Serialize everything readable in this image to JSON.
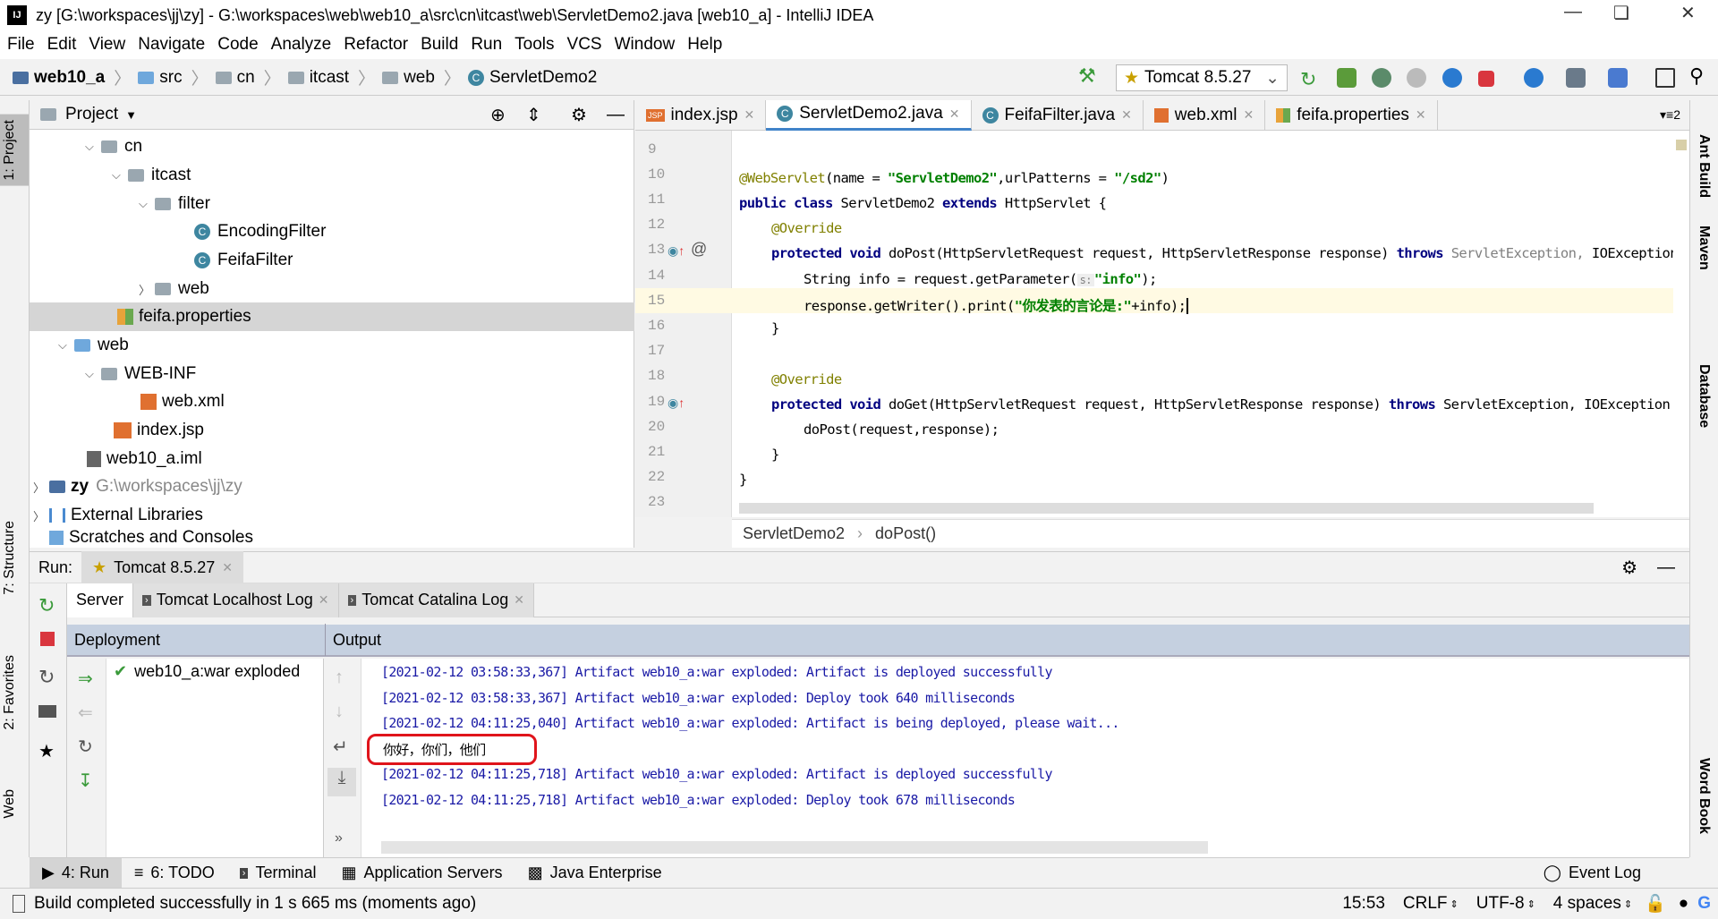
{
  "window": {
    "title": "zy [G:\\workspaces\\jj\\zy] - G:\\workspaces\\web\\web10_a\\src\\cn\\itcast\\web\\ServletDemo2.java [web10_a] - IntelliJ IDEA",
    "logo": "IJ"
  },
  "menu": [
    "File",
    "Edit",
    "View",
    "Navigate",
    "Code",
    "Analyze",
    "Refactor",
    "Build",
    "Run",
    "Tools",
    "VCS",
    "Window",
    "Help"
  ],
  "breadcrumb": [
    "web10_a",
    "src",
    "cn",
    "itcast",
    "web",
    "ServletDemo2"
  ],
  "run_config": "Tomcat 8.5.27",
  "left_strip": [
    "1: Project",
    "7: Structure",
    "2: Favorites",
    "Web"
  ],
  "right_strip": [
    "Ant Build",
    "Maven",
    "Database",
    "Word Book"
  ],
  "project": {
    "header": "Project",
    "tree": [
      {
        "label": "cn",
        "icon": "folder-icon",
        "expanded": true
      },
      {
        "label": "itcast",
        "icon": "folder-icon",
        "expanded": true
      },
      {
        "label": "filter",
        "icon": "folder-icon",
        "expanded": true
      },
      {
        "label": "EncodingFilter",
        "icon": "class-icon"
      },
      {
        "label": "FeifaFilter",
        "icon": "class-icon"
      },
      {
        "label": "web",
        "icon": "folder-icon",
        "expanded": false
      },
      {
        "label": "feifa.properties",
        "icon": "properties-icon",
        "selected": true
      },
      {
        "label": "web",
        "icon": "web-folder-icon",
        "expanded": true
      },
      {
        "label": "WEB-INF",
        "icon": "folder-icon",
        "expanded": true
      },
      {
        "label": "web.xml",
        "icon": "xml-icon"
      },
      {
        "label": "index.jsp",
        "icon": "jsp-icon"
      },
      {
        "label": "web10_a.iml",
        "icon": "iml-icon"
      },
      {
        "label": "zy",
        "icon": "module-icon",
        "expanded": false,
        "hint": "G:\\workspaces\\jj\\zy"
      },
      {
        "label": "External Libraries",
        "icon": "library-icon",
        "expanded": false
      },
      {
        "label": "Scratches and Consoles",
        "icon": "scratch-icon"
      }
    ]
  },
  "editor_tabs": [
    {
      "label": "index.jsp",
      "icon": "JSP"
    },
    {
      "label": "ServletDemo2.java",
      "icon": "C",
      "active": true
    },
    {
      "label": "FeifaFilter.java",
      "icon": "C"
    },
    {
      "label": "web.xml",
      "icon": "XML"
    },
    {
      "label": "feifa.properties",
      "icon": "P"
    }
  ],
  "tabs_count": "2",
  "code": {
    "line_numbers": [
      "9",
      "10",
      "11",
      "12",
      "13",
      "14",
      "15",
      "16",
      "17",
      "18",
      "19",
      "20",
      "21",
      "22",
      "23"
    ],
    "l10a": "@WebServlet",
    "l10b": "(name = ",
    "l10c": "\"ServletDemo2\"",
    "l10d": ",urlPatterns = ",
    "l10e": "\"/sd2\"",
    "l10f": ")",
    "l11a": "public class ",
    "l11b": "ServletDemo2 ",
    "l11c": "extends ",
    "l11d": "HttpServlet {",
    "override": "@Override",
    "l13a": "protected void ",
    "l13b": "doPost(HttpServletRequest request, HttpServletResponse response) ",
    "l13c": "throws ",
    "l13d": "ServletException, ",
    "l13e": "IOException {",
    "l14a": "String info = request.getParameter(",
    "l14hint": "s:",
    "l14b": "\"info\"",
    "l14c": ");",
    "l15a": "response.getWriter().print(",
    "l15b": "\"你发表的言论是:\"",
    "l15c": "+info);",
    "close": "}",
    "l19b": "doGet(HttpServletRequest request, HttpServletResponse response) ",
    "l19d": "ServletException, ",
    "l20": "doPost(request,response);"
  },
  "editor_breadcrumb": [
    "ServletDemo2",
    "doPost()"
  ],
  "run": {
    "label": "Run:",
    "tab": "Tomcat 8.5.27",
    "server_tabs": [
      "Server",
      "Tomcat Localhost Log",
      "Tomcat Catalina Log"
    ],
    "deployment_header": "Deployment",
    "output_header": "Output",
    "deployment_item": "web10_a:war exploded",
    "output": [
      "[2021-02-12 03:58:33,367] Artifact web10_a:war exploded: Artifact is deployed successfully",
      "[2021-02-12 03:58:33,367] Artifact web10_a:war exploded: Deploy took 640 milliseconds",
      "[2021-02-12 04:11:25,040] Artifact web10_a:war exploded: Artifact is being deployed, please wait...",
      "你好，你们，他们",
      "[2021-02-12 04:11:25,718] Artifact web10_a:war exploded: Artifact is deployed successfully",
      "[2021-02-12 04:11:25,718] Artifact web10_a:war exploded: Deploy took 678 milliseconds"
    ],
    "more": "»"
  },
  "bottom_tabs": [
    "4: Run",
    "6: TODO",
    "Terminal",
    "Application Servers",
    "Java Enterprise"
  ],
  "event_log": "Event Log",
  "status": {
    "message": "Build completed successfully in 1 s 665 ms (moments ago)",
    "position": "15:53",
    "line_sep": "CRLF",
    "encoding": "UTF-8",
    "indent": "4 spaces"
  },
  "colors": {
    "accent": "#4083c9",
    "keyword": "#000080",
    "string": "#008000",
    "annotation": "#808000",
    "output": "#1a1aa6",
    "highlight": "#e0141b",
    "header": "#c5d0e0"
  }
}
